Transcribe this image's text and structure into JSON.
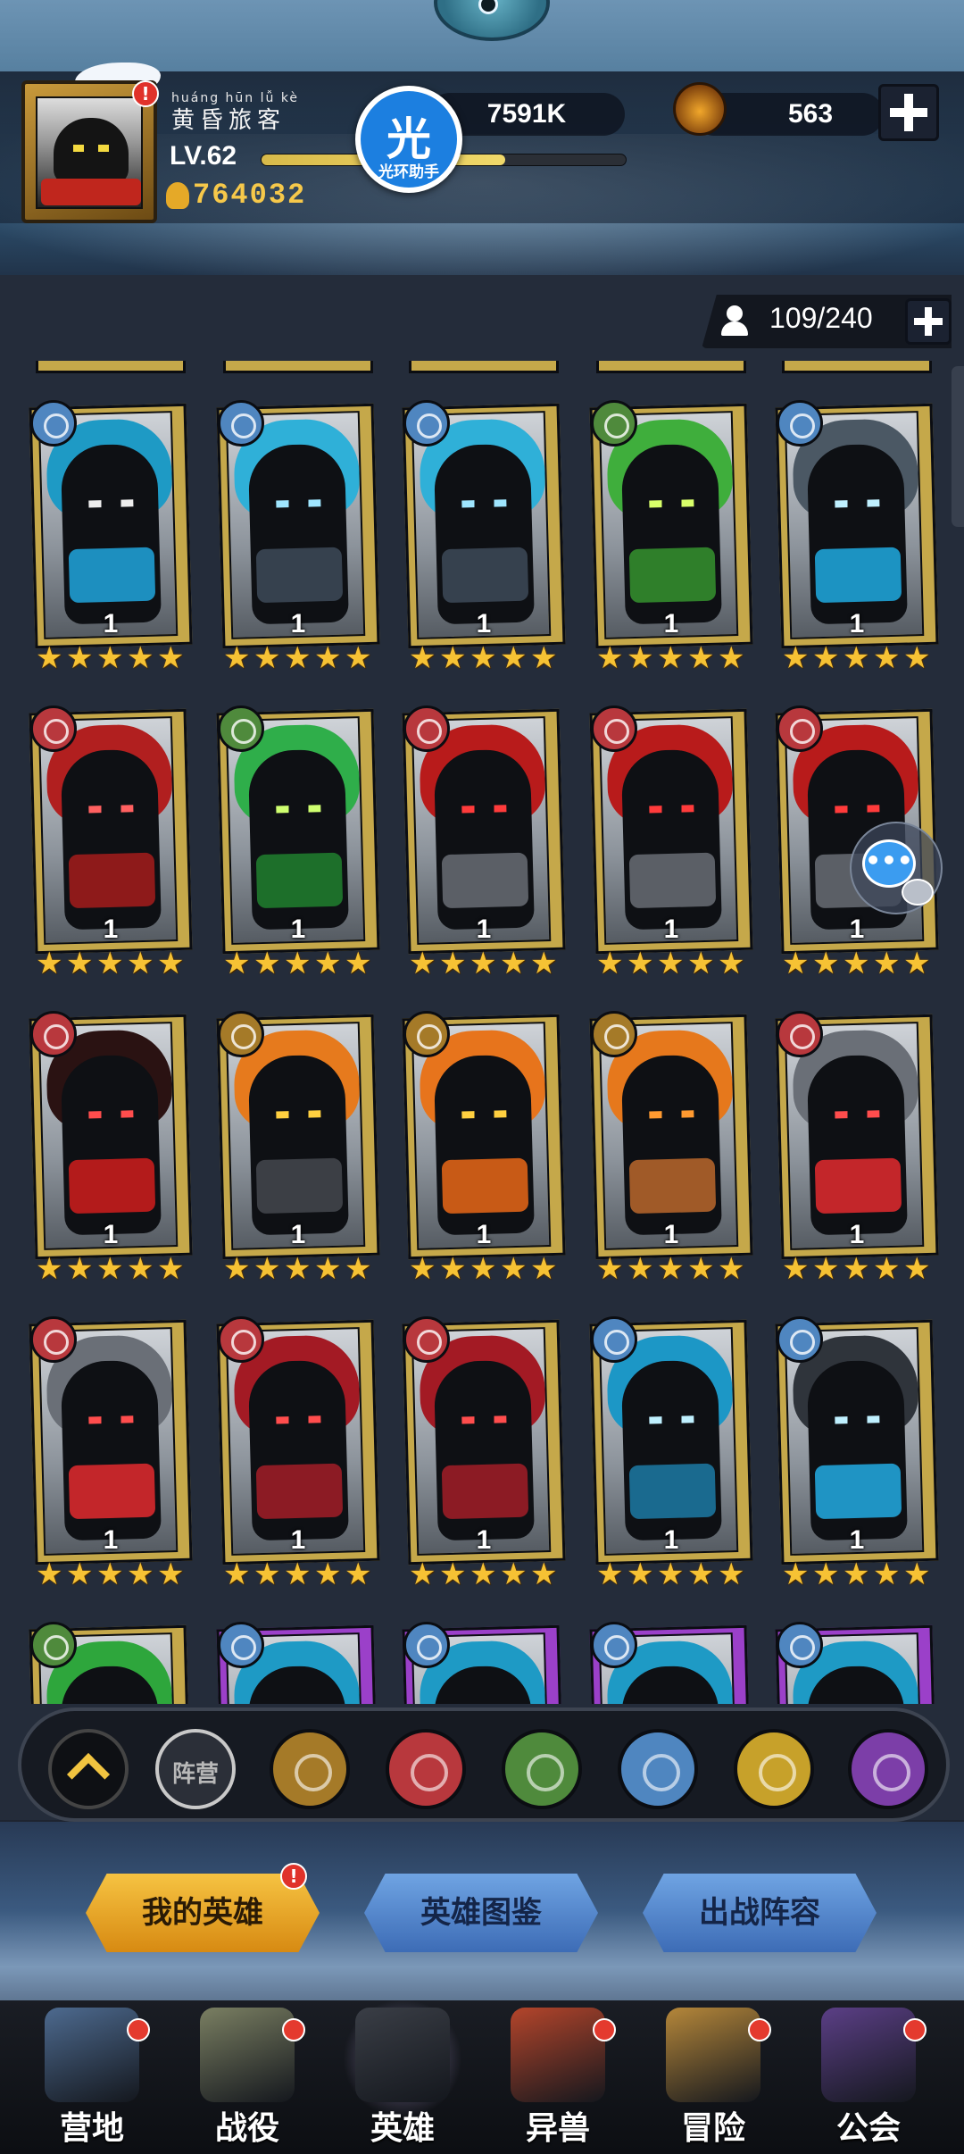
{
  "header": {
    "player_name_pinyin": "huáng hūn lǚ kè",
    "player_name": "黄昏旅客",
    "level": "LV.62",
    "xp_fraction": 0.67,
    "gold": "764032",
    "power": "7591K",
    "medals": "563",
    "helper_badge": "光",
    "helper_label": "光环助手",
    "alert": "!"
  },
  "roster": {
    "capacity": "109/240"
  },
  "heroes": [
    {
      "level": "1",
      "stars": 5,
      "element": "water",
      "frame": "gold",
      "hair": "#1e9ac5",
      "trim": "#1d8fbf",
      "eyes": "#eeeeee"
    },
    {
      "level": "1",
      "stars": 5,
      "element": "water",
      "frame": "gold",
      "hair": "#2fb0d8",
      "trim": "#36414e",
      "eyes": "#9fe6ff"
    },
    {
      "level": "1",
      "stars": 5,
      "element": "water",
      "frame": "gold",
      "hair": "#2fb0d8",
      "trim": "#36414e",
      "eyes": "#9fe6ff"
    },
    {
      "level": "1",
      "stars": 5,
      "element": "nature",
      "frame": "gold",
      "hair": "#3fae3c",
      "trim": "#2f7f2a",
      "eyes": "#d8ff6a"
    },
    {
      "level": "1",
      "stars": 5,
      "element": "water",
      "frame": "gold",
      "hair": "#4b5864",
      "trim": "#1c93c2",
      "eyes": "#bff0ff"
    },
    {
      "level": "1",
      "stars": 5,
      "element": "fire",
      "frame": "gold",
      "hair": "#b11f1f",
      "trim": "#8e1a1a",
      "eyes": "#ff6060"
    },
    {
      "level": "1",
      "stars": 5,
      "element": "nature",
      "frame": "gold",
      "hair": "#2fae4a",
      "trim": "#1d6f2a",
      "eyes": "#cfff70"
    },
    {
      "level": "1",
      "stars": 5,
      "element": "fire",
      "frame": "gold",
      "hair": "#b81b1b",
      "trim": "#5b5f66",
      "eyes": "#ff3b3b"
    },
    {
      "level": "1",
      "stars": 5,
      "element": "fire",
      "frame": "gold",
      "hair": "#b81b1b",
      "trim": "#5b5f66",
      "eyes": "#ff3b3b"
    },
    {
      "level": "1",
      "stars": 5,
      "element": "fire",
      "frame": "gold",
      "hair": "#b81b1b",
      "trim": "#5b5f66",
      "eyes": "#ff3b3b"
    },
    {
      "level": "1",
      "stars": 5,
      "element": "fire",
      "frame": "gold",
      "hair": "#2a1212",
      "trim": "#b31b1b",
      "eyes": "#ff4d4d"
    },
    {
      "level": "1",
      "stars": 5,
      "element": "light",
      "frame": "gold",
      "hair": "#e67a1d",
      "trim": "#3c3f45",
      "eyes": "#ffd040"
    },
    {
      "level": "1",
      "stars": 5,
      "element": "light",
      "frame": "gold",
      "hair": "#e7741c",
      "trim": "#c85a16",
      "eyes": "#ffd040"
    },
    {
      "level": "1",
      "stars": 5,
      "element": "light",
      "frame": "gold",
      "hair": "#e6781c",
      "trim": "#a05a28",
      "eyes": "#ff9a30"
    },
    {
      "level": "1",
      "stars": 5,
      "element": "fire",
      "frame": "gold",
      "hair": "#6a6f77",
      "trim": "#c3262a",
      "eyes": "#ff4d4d"
    },
    {
      "level": "1",
      "stars": 5,
      "element": "fire",
      "frame": "gold",
      "hair": "#6a6f77",
      "trim": "#c3262a",
      "eyes": "#ff4d4d"
    },
    {
      "level": "1",
      "stars": 5,
      "element": "fire",
      "frame": "gold",
      "hair": "#a31a24",
      "trim": "#8c1b24",
      "eyes": "#ff4d4d"
    },
    {
      "level": "1",
      "stars": 5,
      "element": "fire",
      "frame": "gold",
      "hair": "#a31a24",
      "trim": "#8c1b24",
      "eyes": "#ff4d4d"
    },
    {
      "level": "1",
      "stars": 5,
      "element": "water",
      "frame": "gold",
      "hair": "#1c97c6",
      "trim": "#1a6a8f",
      "eyes": "#bff0ff"
    },
    {
      "level": "1",
      "stars": 5,
      "element": "water",
      "frame": "gold",
      "hair": "#2f343b",
      "trim": "#1f94c4",
      "eyes": "#bff0ff"
    },
    {
      "level": "",
      "stars": 0,
      "element": "nature",
      "frame": "gold",
      "hair": "#2ea63c",
      "trim": "#1d6f2a",
      "eyes": "#cfff70"
    },
    {
      "level": "",
      "stars": 0,
      "element": "water",
      "frame": "purple",
      "hair": "#1e9ac5",
      "trim": "#36414e",
      "eyes": "#9fe6ff"
    },
    {
      "level": "",
      "stars": 0,
      "element": "water",
      "frame": "purple",
      "hair": "#1e9ac5",
      "trim": "#36414e",
      "eyes": "#9fe6ff"
    },
    {
      "level": "",
      "stars": 0,
      "element": "water",
      "frame": "purple",
      "hair": "#1e9ac5",
      "trim": "#36414e",
      "eyes": "#9fe6ff"
    },
    {
      "level": "",
      "stars": 0,
      "element": "water",
      "frame": "purple",
      "hair": "#1e9ac5",
      "trim": "#36414e",
      "eyes": "#9fe6ff"
    }
  ],
  "element_colors": {
    "water": "#4f86c0",
    "nature": "#4f8a3c",
    "fire": "#b8383d",
    "light": "#a57a28",
    "holy": "#c7a12a",
    "void": "#7c3ea8"
  },
  "filters": {
    "camp_label": "阵营",
    "items": [
      "up",
      "camp",
      "light",
      "fire",
      "nature",
      "water",
      "holy",
      "void"
    ]
  },
  "tabs": [
    {
      "label": "我的英雄",
      "active": true
    },
    {
      "label": "英雄图鉴",
      "active": false
    },
    {
      "label": "出战阵容",
      "active": false
    }
  ],
  "nav": [
    {
      "label": "营地",
      "icon": "camp-icon",
      "dot": true,
      "active": false,
      "color": "#4d6a8f"
    },
    {
      "label": "战役",
      "icon": "battle-icon",
      "dot": true,
      "active": false,
      "color": "#7a7f62"
    },
    {
      "label": "英雄",
      "icon": "hero-icon",
      "dot": false,
      "active": true,
      "color": "#3a3e46"
    },
    {
      "label": "异兽",
      "icon": "beast-icon",
      "dot": true,
      "active": false,
      "color": "#b4452b"
    },
    {
      "label": "冒险",
      "icon": "adventure-icon",
      "dot": true,
      "active": false,
      "color": "#b5873a"
    },
    {
      "label": "公会",
      "icon": "guild-icon",
      "dot": true,
      "active": false,
      "color": "#5b3f86"
    }
  ],
  "chat": {
    "label": "•••"
  }
}
